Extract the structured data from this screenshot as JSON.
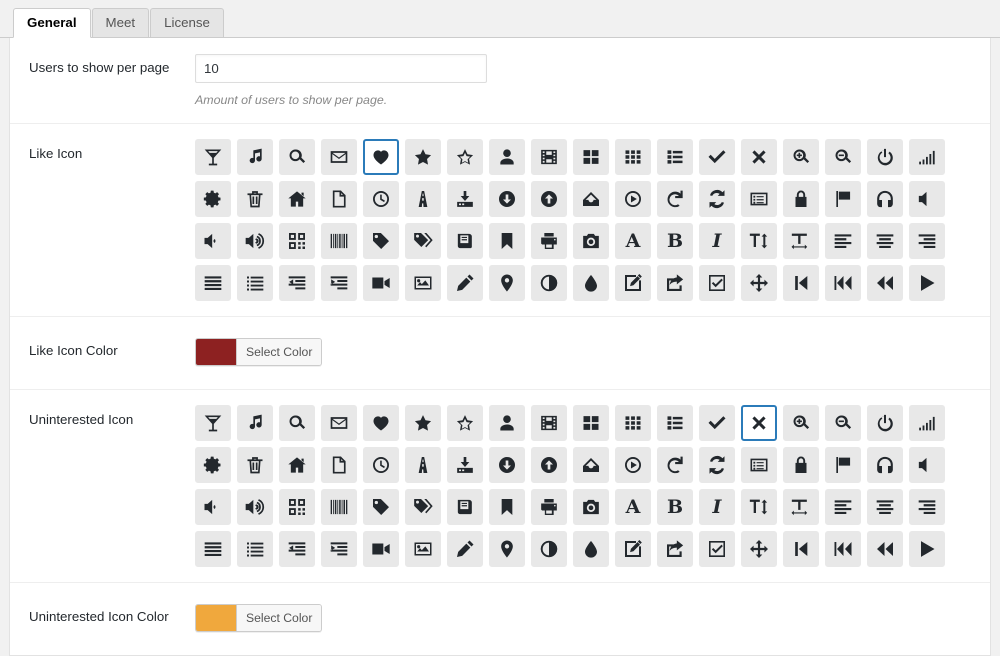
{
  "tabs": [
    {
      "label": "General",
      "active": true
    },
    {
      "label": "Meet",
      "active": false
    },
    {
      "label": "License",
      "active": false
    }
  ],
  "rows": {
    "users_per_page": {
      "label": "Users to show per page",
      "value": "10",
      "placeholder": "",
      "description": "Amount of users to show per page."
    },
    "like_icon": {
      "label": "Like Icon",
      "selected_index": 4
    },
    "like_icon_color": {
      "label": "Like Icon Color",
      "button_label": "Select Color",
      "color": "#8d2121"
    },
    "uninterested_icon": {
      "label": "Uninterested Icon",
      "selected_index": 13
    },
    "uninterested_icon_color": {
      "label": "Uninterested Icon Color",
      "button_label": "Select Color",
      "color": "#f0a83d"
    }
  },
  "icon_set": [
    "cocktail-glass-icon",
    "music-note-icon",
    "magnifier-search-icon",
    "envelope-mail-icon",
    "heart-filled-icon",
    "star-filled-icon",
    "star-outline-icon",
    "user-person-icon",
    "film-strip-icon",
    "grid-four-icon",
    "grid-nine-icon",
    "list-view-icon",
    "checkmark-icon",
    "cross-x-icon",
    "zoom-in-icon",
    "zoom-out-icon",
    "power-off-icon",
    "signal-bars-icon",
    "gear-cog-icon",
    "trash-can-icon",
    "home-house-icon",
    "file-page-icon",
    "clock-time-icon",
    "road-icon",
    "download-tray-icon",
    "arrow-down-circle-icon",
    "arrow-up-circle-icon",
    "inbox-icon",
    "play-circle-icon",
    "refresh-redo-icon",
    "sync-arrows-icon",
    "window-list-icon",
    "lock-closed-icon",
    "flag-icon",
    "headphones-icon",
    "volume-mute-icon",
    "volume-low-icon",
    "volume-high-icon",
    "qr-code-icon",
    "barcode-icon",
    "tag-icon",
    "tags-double-icon",
    "book-icon",
    "bookmark-icon",
    "printer-icon",
    "camera-icon",
    "text-size-a-icon",
    "text-bold-b-icon",
    "text-italic-i-icon",
    "text-height-icon",
    "text-width-icon",
    "align-left-icon",
    "align-center-icon",
    "align-right-icon",
    "align-justify-icon",
    "unordered-list-icon",
    "outdent-icon",
    "indent-icon",
    "video-camera-icon",
    "image-picture-icon",
    "pencil-edit-icon",
    "map-pin-icon",
    "contrast-adjust-icon",
    "droplet-tint-icon",
    "pencil-square-icon",
    "share-export-icon",
    "checkbox-checked-icon",
    "move-arrows-icon",
    "step-backward-icon",
    "fast-backward-icon",
    "rewind-icon",
    "play-triangle-icon"
  ]
}
